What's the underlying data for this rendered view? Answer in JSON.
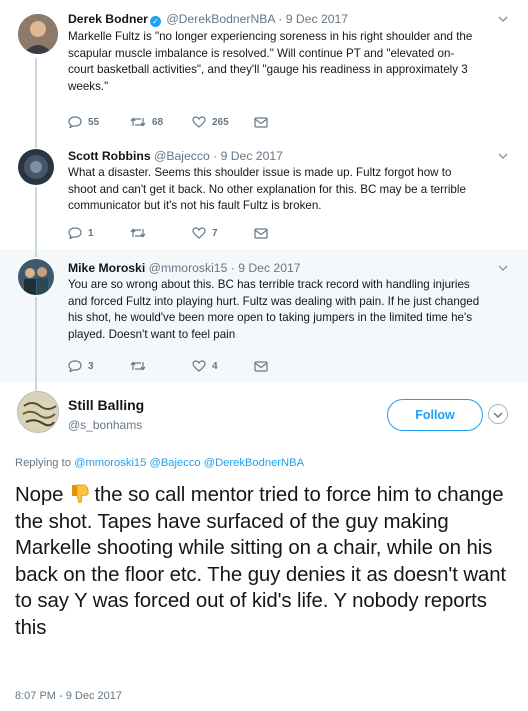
{
  "tweets": [
    {
      "name": "Derek Bodner",
      "verified": true,
      "handle": "@DerekBodnerNBA",
      "date": "9 Dec 2017",
      "lines": [
        "Markelle Fultz is \"no longer experiencing soreness in his right shoulder and the",
        "scapular muscle imbalance is resolved.\" Will continue PT and \"elevated on-",
        "court basketball activities\", and they'll \"gauge his readiness in approximately 3",
        "weeks.\""
      ],
      "replies": "55",
      "retweets": "68",
      "likes": "265"
    },
    {
      "name": "Scott Robbins",
      "handle": "@Bajecco",
      "date": "9 Dec 2017",
      "lines": [
        "What a disaster. Seems this shoulder issue is made up. Fultz forgot how to",
        "shoot and can't get it back. No other explanation for this. BC may be a terrible",
        "communicator but it's not his fault Fultz is broken."
      ],
      "replies": "1",
      "retweets": "",
      "likes": "7"
    },
    {
      "name": "Mike Moroski",
      "handle": "@mmoroski15",
      "date": "9 Dec 2017",
      "lines": [
        "You are so wrong about this. BC has terrible track record with handling injuries",
        "and forced Fultz into playing hurt. Fultz was dealing with pain. If he just changed",
        "his shot, he would've been more open to taking jumpers in the limited time he's",
        "played. Doesn't want to feel pain"
      ],
      "replies": "3",
      "retweets": "",
      "likes": "4"
    }
  ],
  "main": {
    "name": "Still Balling",
    "handle": "@s_bonhams",
    "follow_label": "Follow",
    "replying_prefix": "Replying to",
    "replying_mentions": "@mmoroski15 @Bajecco @DerekBodnerNBA",
    "text_before_emoji": "Nope ",
    "text_after_emoji": " the so call mentor tried to force him to change the shot. Tapes have surfaced of the guy making Markelle shooting while sitting on a chair, while on his back on the floor etc. The guy denies it as doesn't want to say Y was forced out of kid's life. Y nobody reports this",
    "timestamp": "8:07 PM - 9 Dec 2017"
  },
  "icons": {
    "reply": "reply-icon",
    "retweet": "retweet-icon",
    "like": "heart-icon",
    "dm": "envelope-icon",
    "emoji": "thumbs-down-emoji"
  },
  "colors": {
    "accent": "#1da1f2",
    "muted": "#657786",
    "text": "#14171a"
  }
}
